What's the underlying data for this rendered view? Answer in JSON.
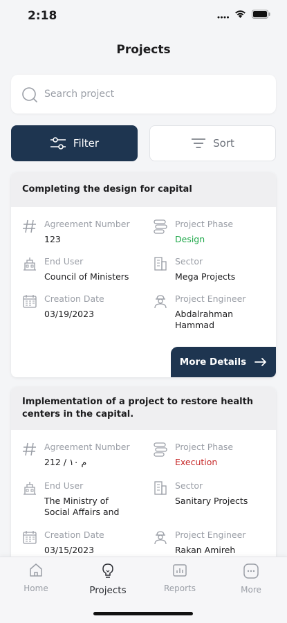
{
  "status_bar": {
    "time": "2:18"
  },
  "header": {
    "title": "Projects"
  },
  "search": {
    "placeholder": "Search project"
  },
  "actions": {
    "filter_label": "Filter",
    "sort_label": "Sort"
  },
  "projects": [
    {
      "title": "Completing the design for capital",
      "agreement_label": "Agreement Number",
      "agreement_value": "123",
      "phase_label": "Project Phase",
      "phase_value": "Design",
      "end_user_label": "End User",
      "end_user_value": "Council of Ministers",
      "sector_label": "Sector",
      "sector_value": "Mega Projects",
      "creation_label": "Creation Date",
      "creation_value": "03/19/2023",
      "engineer_label": "Project Engineer",
      "engineer_value": "Abdalrahman Hammad",
      "more_label": "More Details"
    },
    {
      "title": "Implementation of a project to restore health centers in the capital.",
      "agreement_label": "Agreement Number",
      "agreement_value": "212 / م ١٠",
      "phase_label": "Project Phase",
      "phase_value": "Execution",
      "end_user_label": "End User",
      "end_user_value": "The Ministry of Social Affairs and",
      "sector_label": "Sector",
      "sector_value": "Sanitary Projects",
      "creation_label": "Creation Date",
      "creation_value": "03/15/2023",
      "engineer_label": "Project Engineer",
      "engineer_value": "Rakan Amireh"
    }
  ],
  "tabbar": {
    "home": "Home",
    "projects": "Projects",
    "reports": "Reports",
    "more": "More"
  },
  "colors": {
    "primary": "#1e3550",
    "phase_design": "#1fa84a",
    "phase_execution": "#c62828"
  }
}
